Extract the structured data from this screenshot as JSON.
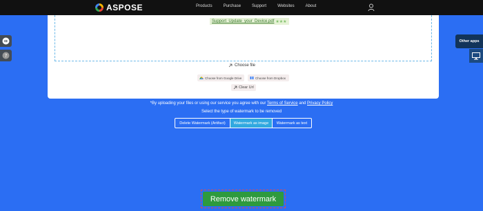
{
  "header": {
    "logo_text": "ASPOSE",
    "nav": [
      "Products",
      "Purchase",
      "Support",
      "Websites",
      "About"
    ],
    "user_icon": "user-icon"
  },
  "upload": {
    "file_name": "Support_Update_your_Device.pdf",
    "file_stars": "★★★",
    "choose_file": "Choose file",
    "google_drive": "Choose from Google Drive",
    "dropbox": "Choose from Dropbox",
    "clear": "Clear Url"
  },
  "terms": {
    "prefix": "*By uploading your files or using our service you agree with our",
    "tos": "Terms of Service",
    "and": "and",
    "privacy": "Privacy Policy"
  },
  "watermark_type": {
    "label": "Select the type of watermark to be removed",
    "options": [
      "Delete Watermark (Artifact)",
      "Watermark as image",
      "Watermark as text"
    ],
    "selected": "Watermark as image"
  },
  "sidebar": {
    "other_apps": "Other apps"
  },
  "actions": {
    "remove": "Remove watermark"
  },
  "colors": {
    "background": "#2b6ef3",
    "accent_green": "#2e9a3e",
    "selected_option": "#31a9e0"
  }
}
